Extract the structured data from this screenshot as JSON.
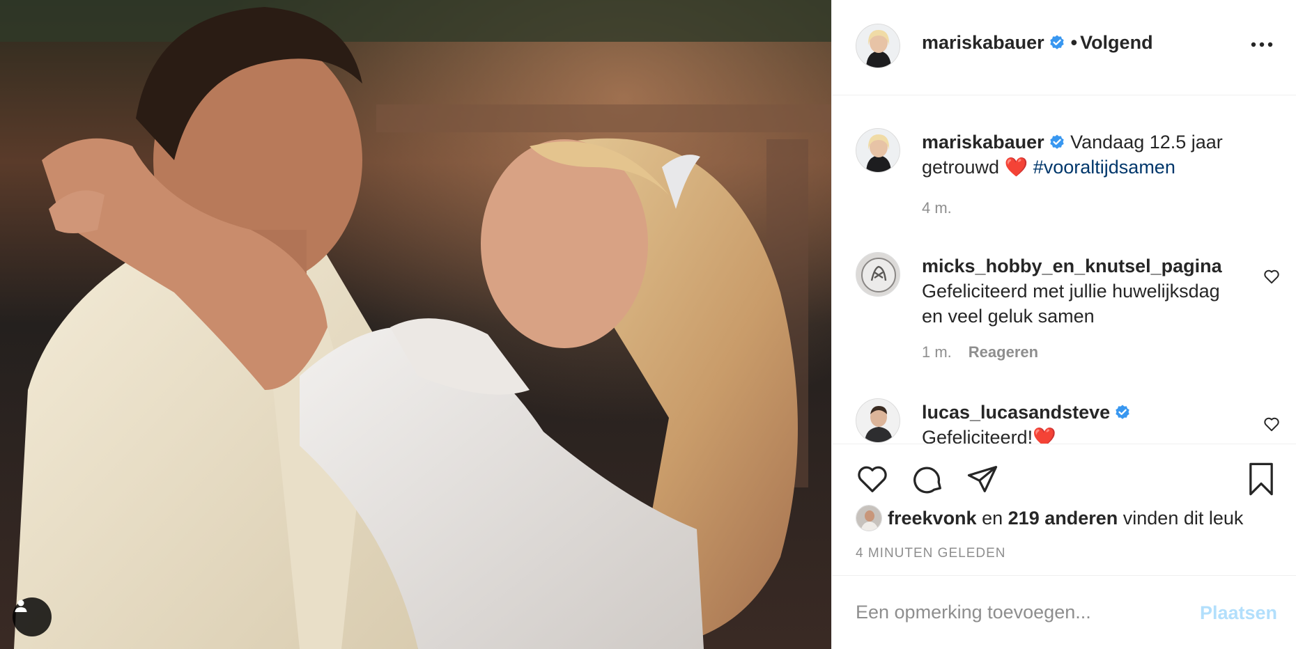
{
  "post": {
    "author": "mariskabauer",
    "follow_state": "Volgend",
    "separator": "•",
    "verified": true,
    "more_icon": "more-horizontal-icon",
    "tag_icon": "user-tag-icon"
  },
  "comments": [
    {
      "username": "mariskabauer",
      "verified": true,
      "text": "Vandaag 12.5 jaar getrouwd",
      "emoji": "❤️",
      "hashtag": "#vooraltijdsamen",
      "time": "4 m."
    },
    {
      "username": "micks_hobby_en_knutsel_pagina",
      "verified": false,
      "text": "Gefeliciteerd met jullie huwelijksdag en veel geluk samen",
      "time": "1 m.",
      "reply_label": "Reageren"
    },
    {
      "username": "lucas_lucasandsteve",
      "verified": true,
      "text": "Gefeliciteerd!❤️"
    }
  ],
  "likes": {
    "first_liker": "freekvonk",
    "connector": "en",
    "others": "219 anderen",
    "suffix": "vinden dit leuk"
  },
  "timestamp": "4 MINUTEN GELEDEN",
  "add_comment": {
    "placeholder": "Een opmerking toevoegen...",
    "post_label": "Plaatsen"
  },
  "colors": {
    "verified_blue": "#3897f0",
    "link_blue": "#00376b",
    "post_button_disabled": "#b2dffc",
    "heart_red": "#ed4956",
    "muted_gray": "#8e8e8e"
  }
}
